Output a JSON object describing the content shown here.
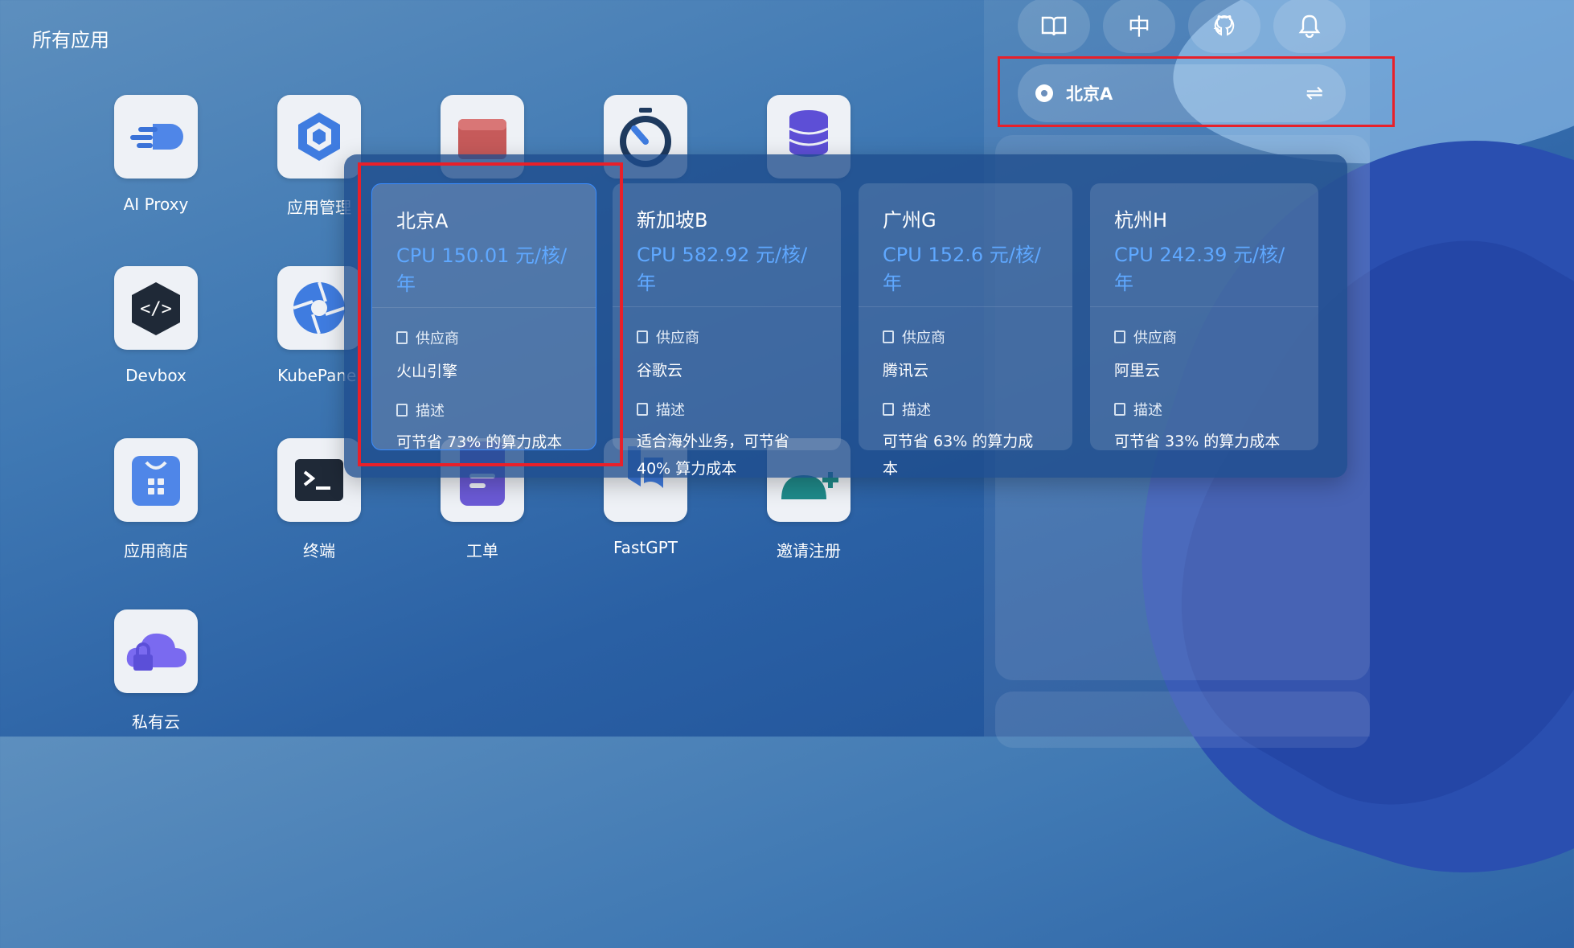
{
  "section_title": "所有应用",
  "apps": [
    {
      "label": "AI Proxy"
    },
    {
      "label": "应用管理"
    },
    {
      "label": ""
    },
    {
      "label": ""
    },
    {
      "label": ""
    },
    {
      "label": "Devbox"
    },
    {
      "label": "KubePanel"
    },
    {
      "label": "应用商店"
    },
    {
      "label": "终端"
    },
    {
      "label": "工单"
    },
    {
      "label": "FastGPT"
    },
    {
      "label": "邀请注册"
    },
    {
      "label": "私有云"
    }
  ],
  "toolbar": {
    "docs_icon": "book-icon",
    "lang_label": "中",
    "github_icon": "github-icon",
    "notify_icon": "bell-icon"
  },
  "region_selector": {
    "current": "北京A",
    "swap_icon": "swap-icon"
  },
  "regions": [
    {
      "name": "北京A",
      "price": "CPU 150.01 元/核/年",
      "provider_label": "供应商",
      "provider": "火山引擎",
      "desc_label": "描述",
      "desc": "可节省 73% 的算力成本"
    },
    {
      "name": "新加坡B",
      "price": "CPU 582.92 元/核/年",
      "provider_label": "供应商",
      "provider": "谷歌云",
      "desc_label": "描述",
      "desc": "适合海外业务，可节省 40% 算力成本"
    },
    {
      "name": "广州G",
      "price": "CPU 152.6 元/核/年",
      "provider_label": "供应商",
      "provider": "腾讯云",
      "desc_label": "描述",
      "desc": "可节省 63% 的算力成本"
    },
    {
      "name": "杭州H",
      "price": "CPU 242.39 元/核/年",
      "provider_label": "供应商",
      "provider": "阿里云",
      "desc_label": "描述",
      "desc": "可节省 33% 的算力成本"
    }
  ],
  "colors": {
    "accent": "#5fa8ff",
    "highlight": "#e8202a"
  }
}
